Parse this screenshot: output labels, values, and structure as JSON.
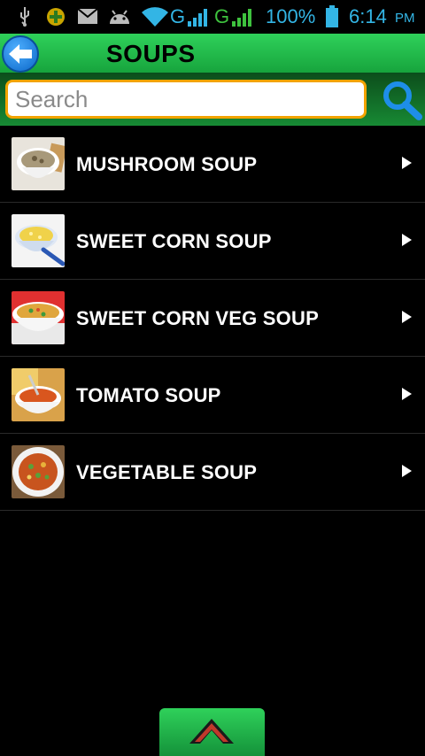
{
  "status_bar": {
    "battery": "100%",
    "time": "6:14",
    "ampm": "PM",
    "network_1": "G",
    "network_2": "G",
    "icons": [
      "usb-icon",
      "settings-badge-icon",
      "mail-icon",
      "android-icon",
      "wifi-icon",
      "signal-icon",
      "signal-icon",
      "battery-icon"
    ]
  },
  "header": {
    "title": "SOUPS",
    "back_icon": "arrow-left-icon"
  },
  "search": {
    "placeholder": "Search",
    "value": "",
    "icon": "search-icon"
  },
  "items": [
    {
      "label": "MUSHROOM SOUP"
    },
    {
      "label": "SWEET CORN SOUP"
    },
    {
      "label": "SWEET CORN VEG SOUP"
    },
    {
      "label": "TOMATO SOUP"
    },
    {
      "label": "VEGETABLE SOUP"
    }
  ],
  "footer": {
    "icon": "chevron-up-icon"
  },
  "colors": {
    "header_green": "#2fd15a",
    "search_border": "#f2a300",
    "status_blue": "#33b5e5",
    "search_icon_blue": "#1e8ee8"
  }
}
